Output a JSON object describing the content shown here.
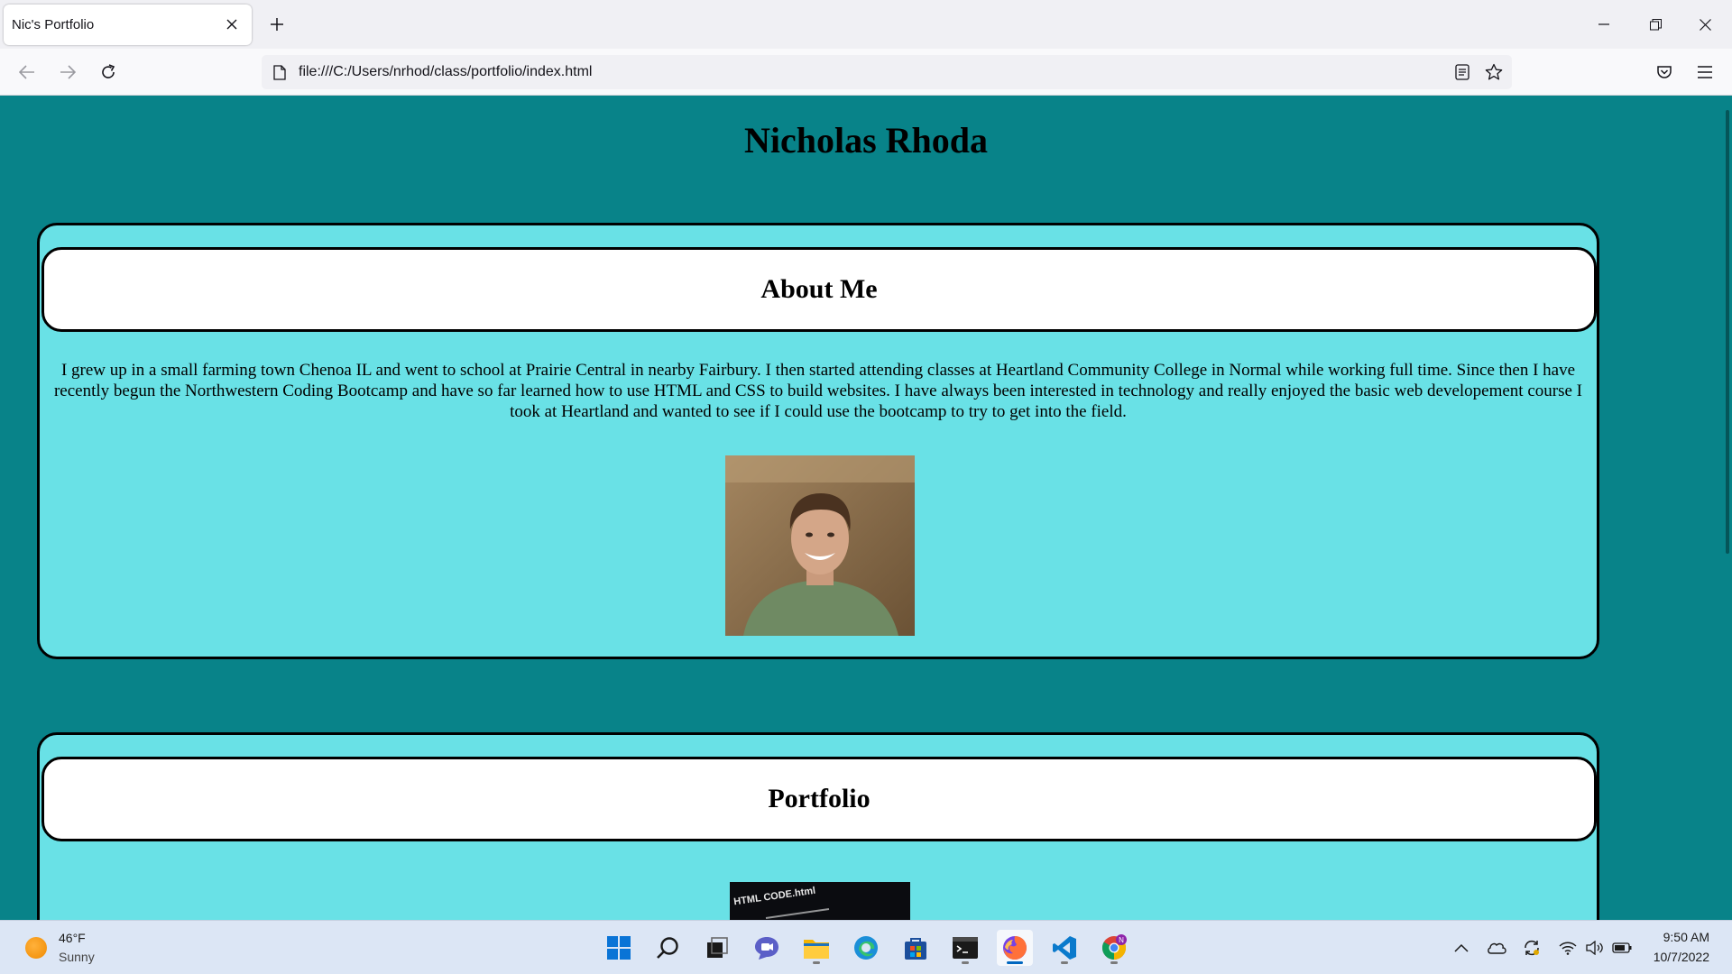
{
  "browser": {
    "tab_title": "Nic's Portfolio",
    "url": "file:///C:/Users/nrhod/class/portfolio/index.html"
  },
  "page": {
    "site_title": "Nicholas Rhoda",
    "about": {
      "heading": "About Me",
      "text": "I grew up in a small farming town Chenoa IL and went to school at Prairie Central in nearby Fairbury. I then started attending classes at Heartland Community College in Normal while working full time. Since then I have recently begun the Northwestern Coding Bootcamp and have so far learned how to use HTML and CSS to build websites. I have always been interested in technology and really enjoyed the basic web developement course I took at Heartland and wanted to see if I could use the bootcamp to try to get into the field."
    },
    "portfolio": {
      "heading": "Portfolio",
      "thumb_caption": "HTML CODE.html"
    },
    "colors": {
      "page_bg": "#088389",
      "section_bg": "#69e1e6",
      "header_bg": "#ffffff"
    }
  },
  "taskbar": {
    "weather_temp": "46°F",
    "weather_desc": "Sunny",
    "time": "9:50 AM",
    "date": "10/7/2022",
    "apps": [
      "start-icon",
      "search-icon",
      "task-view-icon",
      "chat-icon",
      "file-explorer-icon",
      "edge-icon",
      "store-icon",
      "terminal-icon",
      "firefox-icon",
      "vscode-icon",
      "chrome-icon"
    ]
  }
}
